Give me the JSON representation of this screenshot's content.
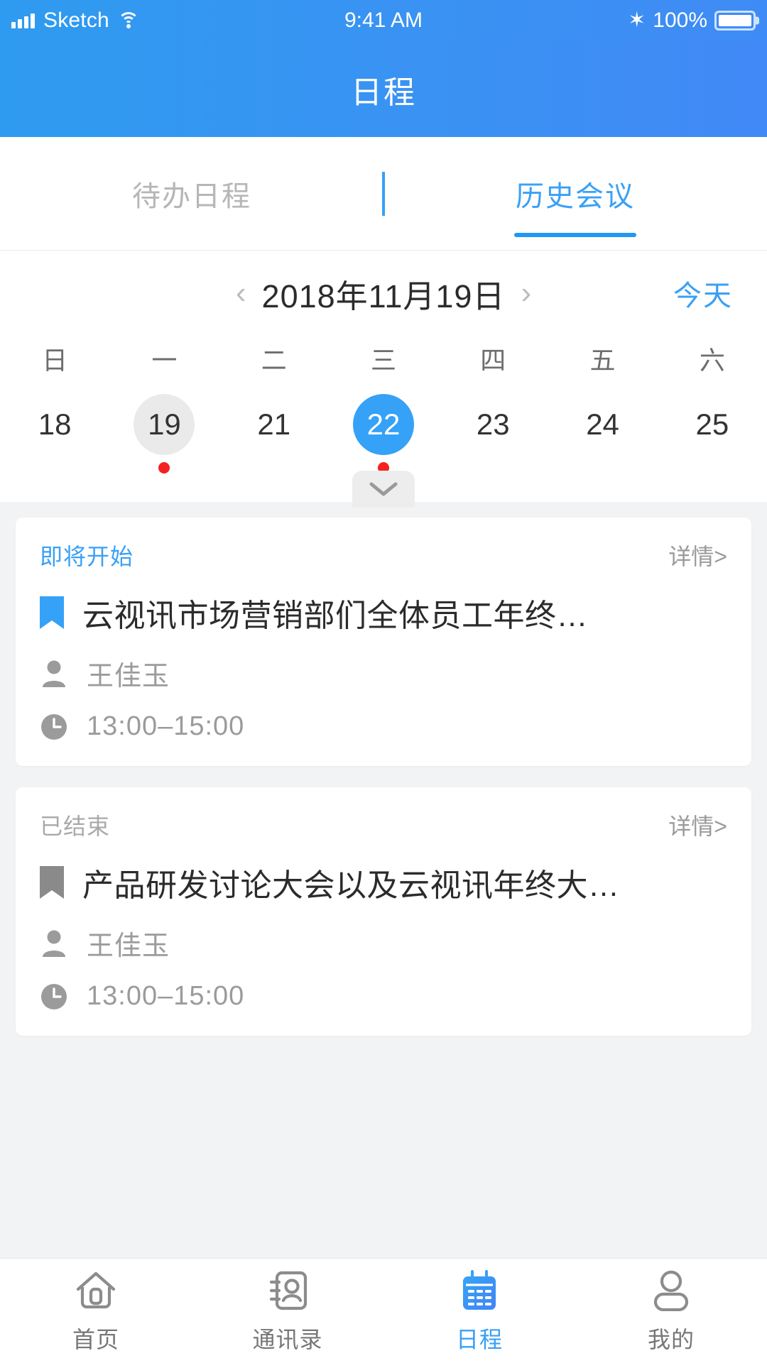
{
  "statusbar": {
    "carrier": "Sketch",
    "time": "9:41 AM",
    "battery_pct": "100%",
    "signal_icon": "signal-bars-icon",
    "wifi_icon": "wifi-icon",
    "bluetooth_icon": "bluetooth-icon",
    "bluetooth_glyph": "✶",
    "battery_icon": "battery-full-icon"
  },
  "header": {
    "title": "日程"
  },
  "tabs": {
    "items": [
      {
        "label": "待办日程",
        "active": false
      },
      {
        "label": "历史会议",
        "active": true
      }
    ]
  },
  "datebar": {
    "prev_icon": "chevron-left-icon",
    "next_icon": "chevron-right-icon",
    "prev_glyph": "‹",
    "next_glyph": "›",
    "current_date": "2018年11月19日",
    "today_label": "今天",
    "weekdays": [
      "日",
      "一",
      "二",
      "三",
      "四",
      "五",
      "六"
    ],
    "days": [
      {
        "num": "18",
        "selected": false,
        "today": false,
        "dot": false
      },
      {
        "num": "19",
        "selected": false,
        "today": true,
        "dot": true
      },
      {
        "num": "21",
        "selected": false,
        "today": false,
        "dot": false
      },
      {
        "num": "22",
        "selected": true,
        "today": false,
        "dot": true
      },
      {
        "num": "23",
        "selected": false,
        "today": false,
        "dot": false
      },
      {
        "num": "24",
        "selected": false,
        "today": false,
        "dot": false
      },
      {
        "num": "25",
        "selected": false,
        "today": false,
        "dot": false
      }
    ],
    "expand_icon": "chevron-down-icon"
  },
  "meetings": [
    {
      "status": "即将开始",
      "status_type": "upcoming",
      "detail_label": "详情>",
      "title": "云视讯市场营销部们全体员工年终…",
      "ribbon_icon": "bookmark-icon",
      "organizer_icon": "person-icon",
      "organizer": "王佳玉",
      "time_icon": "clock-icon",
      "time": "13:00–15:00"
    },
    {
      "status": "已结束",
      "status_type": "ended",
      "detail_label": "详情>",
      "title": "产品研发讨论大会以及云视讯年终大…",
      "ribbon_icon": "bookmark-icon",
      "organizer_icon": "person-icon",
      "organizer": "王佳玉",
      "time_icon": "clock-icon",
      "time": "13:00–15:00"
    }
  ],
  "tabbar": {
    "items": [
      {
        "label": "首页",
        "icon": "home-icon",
        "active": false
      },
      {
        "label": "通讯录",
        "icon": "contacts-icon",
        "active": false
      },
      {
        "label": "日程",
        "icon": "calendar-icon",
        "active": true
      },
      {
        "label": "我的",
        "icon": "profile-icon",
        "active": false
      }
    ]
  },
  "colors": {
    "brand_blue": "#3aa0f5",
    "accent_blue": "#2196f3",
    "dot_red": "#f52020",
    "page_bg": "#f2f3f5",
    "muted_gray": "#9b9b9b"
  }
}
